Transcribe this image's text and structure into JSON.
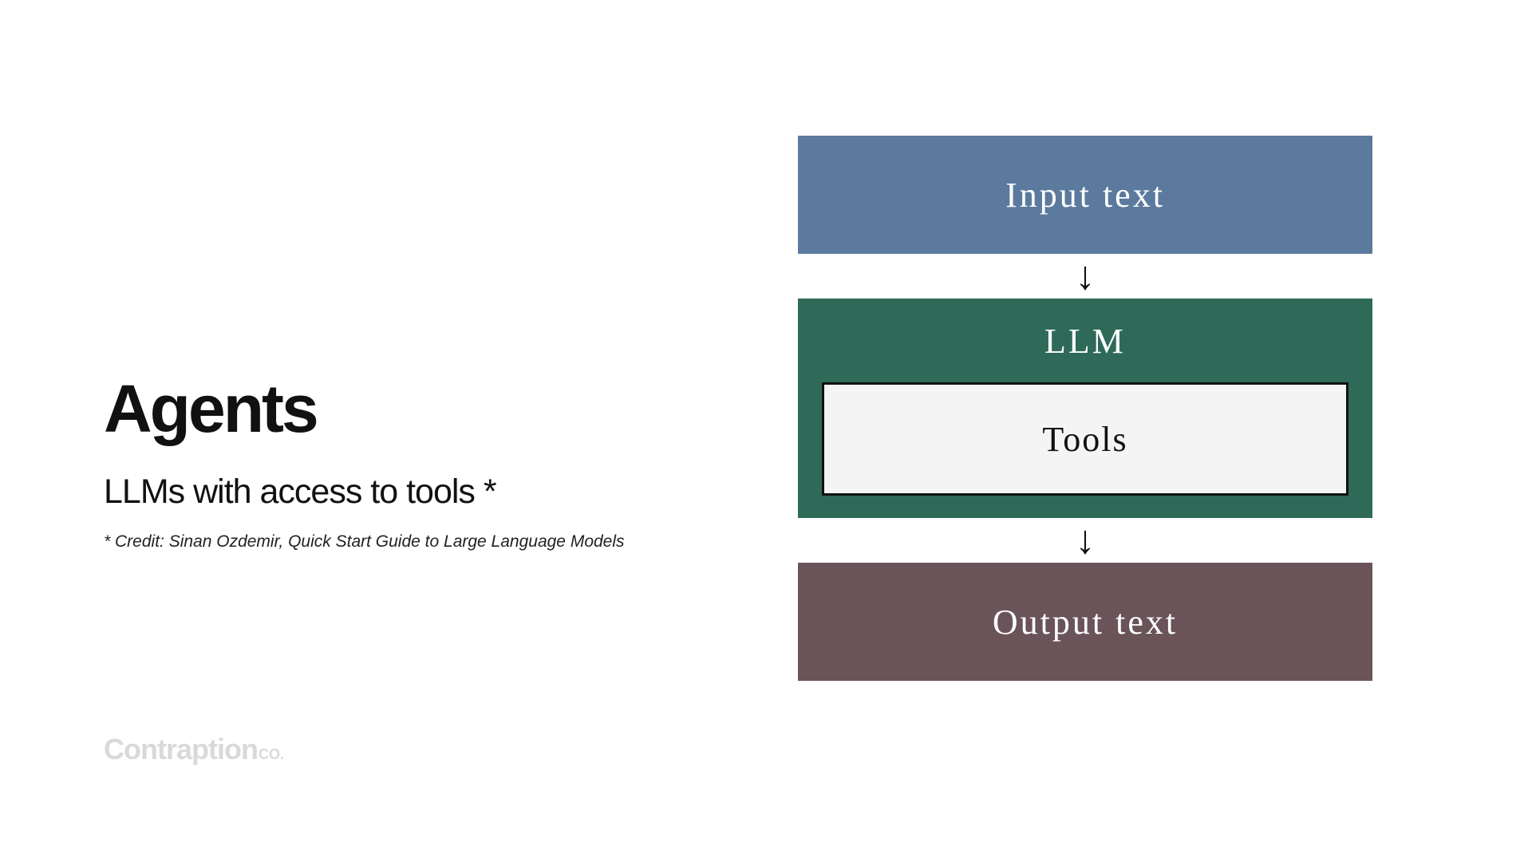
{
  "left": {
    "title": "Agents",
    "subtitle": "LLMs with access to tools *",
    "credit": "* Credit: Sinan Ozdemir, Quick Start Guide to Large Language Models"
  },
  "logo": {
    "main": "Contraption",
    "suffix": "CO."
  },
  "diagram": {
    "input": "Input text",
    "llm": "LLM",
    "tools": "Tools",
    "output": "Output text"
  },
  "colors": {
    "input": "#5b7a9d",
    "llm": "#2f6a59",
    "output": "#6a5459",
    "tools_bg": "#f4f4f4"
  }
}
